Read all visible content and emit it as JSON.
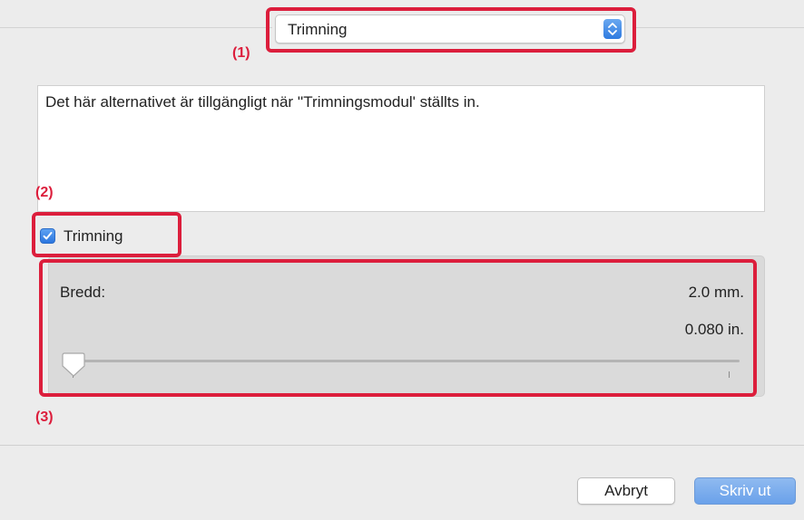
{
  "popup": {
    "selected": "Trimning"
  },
  "annotations": {
    "a1": "(1)",
    "a2": "(2)",
    "a3": "(3)"
  },
  "description": {
    "text": "Det här alternativet är tillgängligt när ''Trimningsmodul' ställts in."
  },
  "checkbox": {
    "label": "Trimning",
    "checked": true
  },
  "slider": {
    "label": "Bredd:",
    "value_mm": "2.0 mm.",
    "value_in": "0.080 in."
  },
  "buttons": {
    "cancel": "Avbryt",
    "print": "Skriv ut"
  },
  "colors": {
    "annotation_red": "#dc1e3c",
    "accent_blue": "#2f7be0"
  }
}
